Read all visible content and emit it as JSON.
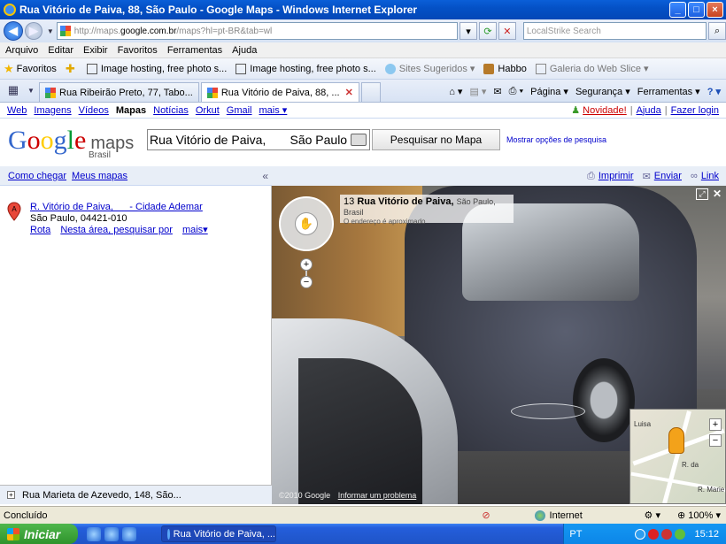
{
  "window": {
    "title": "Rua Vitório de Paiva, 88, São Paulo - Google Maps - Windows Internet Explorer",
    "minimize": "_",
    "maximize": "□",
    "close": "×"
  },
  "address_bar": {
    "url_prefix": "http://maps.",
    "url_host": "google.com.br",
    "url_path": "/maps?hl=pt-BR&tab=wl",
    "search_placeholder": "LocalStrike Search"
  },
  "menu": [
    "Arquivo",
    "Editar",
    "Exibir",
    "Favoritos",
    "Ferramentas",
    "Ajuda"
  ],
  "favorites_bar": {
    "favorites_label": "Favoritos",
    "items": [
      "Image hosting, free photo s...",
      "Image hosting, free photo s...",
      "Sites Sugeridos ▾",
      "Habbo",
      "Galeria do Web Slice ▾"
    ]
  },
  "tabs": [
    {
      "label": "Rua Ribeirão Preto, 77, Tabo..."
    },
    {
      "label": "Rua Vitório de Paiva, 88, ..."
    }
  ],
  "command_bar": {
    "page": "Página ▾",
    "security": "Segurança ▾",
    "tools": "Ferramentas ▾",
    "help": "? ▾"
  },
  "google_bar": {
    "links": [
      "Web",
      "Imagens",
      "Vídeos"
    ],
    "active": "Mapas",
    "links2": [
      "Notícias",
      "Orkut",
      "Gmail"
    ],
    "more": "mais ▾",
    "novidade": "Novidade!",
    "help": "Ajuda",
    "login": "Fazer login"
  },
  "logo": {
    "maps": "maps",
    "country": "Brasil"
  },
  "search": {
    "query": "Rua Vitório de Paiva,       São Paulo",
    "button": "Pesquisar no Mapa",
    "options": "Mostrar opções de pesquisa"
  },
  "left_panel": {
    "get_directions": "Como chegar",
    "my_maps": "Meus mapas",
    "collapse": "«",
    "result": {
      "marker_letter": "A",
      "title": "R. Vitório de Paiva,      - Cidade Ademar",
      "city": "São Paulo, 04421-010",
      "route": "Rota",
      "nearby": "Nesta área, pesquisar por",
      "more": "mais▾"
    },
    "bottom_item": "Rua Marieta de Azevedo, 148, São..."
  },
  "map_header": {
    "print": "Imprimir",
    "send": "Enviar",
    "link": "Link"
  },
  "street_view": {
    "address_number": "13",
    "address_street": "Rua Vitório de Paiva,",
    "address_city": "São Paulo, Brasil",
    "approx": "O endereço é aproximado",
    "copyright": "©2010 Google",
    "report": "Informar um problema",
    "minimap_labels": [
      "Luisa",
      "R. Marie",
      "R. da"
    ]
  },
  "status_bar": {
    "status": "Concluído",
    "zone": "Internet",
    "zoom": "100%"
  },
  "taskbar": {
    "start": "Iniciar",
    "task": "Rua Vitório de Paiva, ...",
    "lang": "PT",
    "clock": "15:12"
  }
}
